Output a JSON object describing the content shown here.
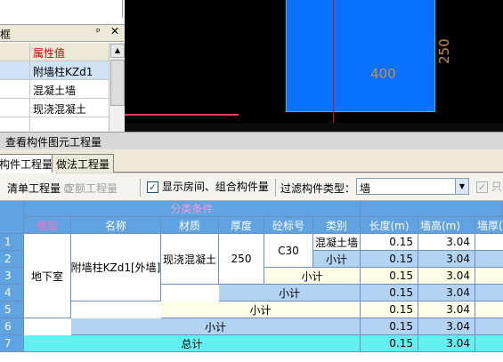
{
  "property_panel": {
    "title": "框",
    "pin_glyph": "ᵖ",
    "close_glyph": "✕",
    "header_value": "属性值",
    "rows": [
      "附墙柱KZd1",
      "混凝土墙",
      "现浇混凝土"
    ]
  },
  "cad": {
    "dim_width": "400",
    "dim_height": "250"
  },
  "dialog": {
    "title": "查看构件图元工程量",
    "tabs": [
      "构件工程量",
      "做法工程量"
    ],
    "radio_list": "清单工程量",
    "radio_quota": "定额工程量",
    "checkbox_show": "显示房间、组合构件量",
    "checkbox_show_checked": true,
    "filter_label": "过滤构件类型：",
    "filter_value": "墙",
    "checkbox_only": "只"
  },
  "grid": {
    "group_header": "分类条件",
    "columns": [
      "楼层",
      "名称",
      "材质",
      "厚度",
      "砼标号",
      "类别",
      "长度(m)",
      "墙高(m)",
      "墙厚(m)"
    ],
    "row_numbers": [
      "1",
      "2",
      "3",
      "4",
      "5",
      "6",
      "7"
    ],
    "floor": "地下室",
    "name": "附墙柱KZd1[外墙]",
    "material": "现浇混凝土",
    "thickness": "250",
    "grade": "C30",
    "category": "混凝土墙",
    "subtotal": "小计",
    "total": "总计",
    "lengths": [
      "0.15",
      "0.15",
      "0.15",
      "0.15",
      "0.15",
      "0.15",
      "0.15"
    ],
    "heights": [
      "3.04",
      "3.04",
      "3.04",
      "3.04",
      "3.04",
      "3.04",
      "3.04"
    ]
  }
}
